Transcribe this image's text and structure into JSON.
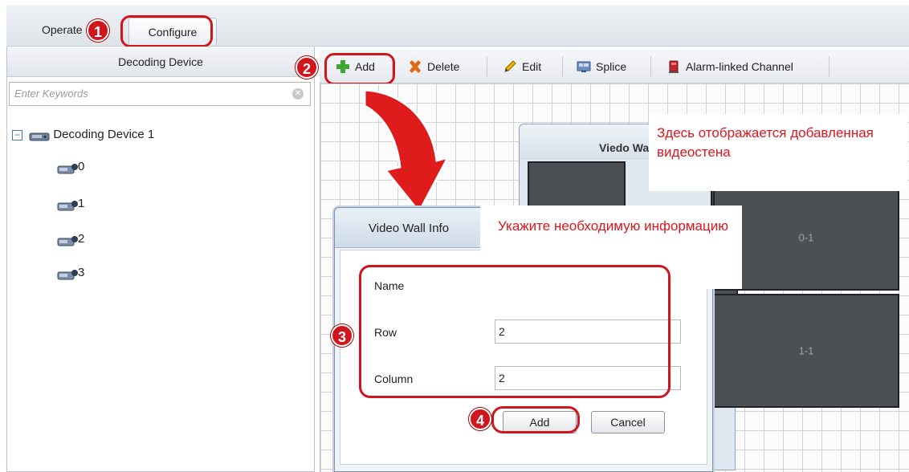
{
  "tabs": [
    {
      "label": "Operate"
    },
    {
      "label": "Configure",
      "selected": true
    }
  ],
  "left_panel": {
    "title": "Decoding Device",
    "search_placeholder": "Enter Keywords",
    "tree": {
      "root": "Decoding Device 1",
      "children": [
        "0",
        "1",
        "2",
        "3"
      ]
    }
  },
  "toolbar": {
    "add": "Add",
    "delete": "Delete",
    "edit": "Edit",
    "splice": "Splice",
    "alarm": "Alarm-linked Channel"
  },
  "video_wall": {
    "title": "Viedo Wall",
    "cells": [
      "0-1",
      "1-1"
    ]
  },
  "dialog": {
    "title": "Video Wall Info",
    "fields": {
      "name_label": "Name",
      "row_label": "Row",
      "row_value": "2",
      "column_label": "Column",
      "column_value": "2"
    },
    "add_button": "Add",
    "cancel_button": "Cancel"
  },
  "annotations": {
    "step_badges": [
      "1",
      "2",
      "3",
      "4"
    ],
    "callout_wall": "Здесь отображается добавленная видеостена",
    "callout_info": "Укажите необходимую информацию"
  },
  "colors": {
    "annotation_red": "#d0151c",
    "wall_cell": "#4c4f53"
  }
}
